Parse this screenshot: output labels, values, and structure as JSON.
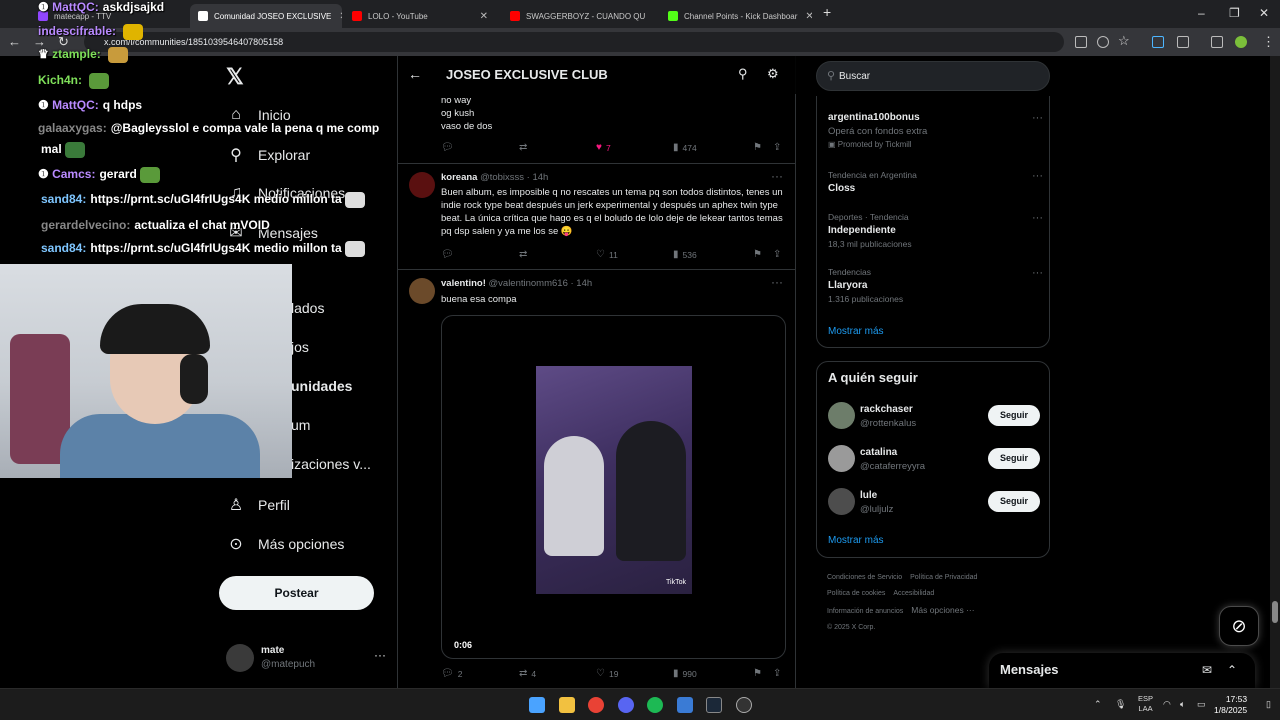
{
  "browser": {
    "tabs": [
      {
        "label": "matecapp - TTV",
        "color": "#9146ff"
      },
      {
        "label": "Comunidad JOSEO EXCLUSIVE",
        "color": "#ffffff"
      },
      {
        "label": "LOLO - YouTube",
        "color": "#ff0000"
      },
      {
        "label": "SWAGGERBOYZ - CUANDO QU",
        "color": "#ff0000"
      },
      {
        "label": "Channel Points - Kick Dashboar",
        "color": "#53fc18"
      }
    ],
    "url": "x.com/i/communities/1851039546407805158"
  },
  "nav": {
    "items": [
      {
        "label": "Inicio",
        "icon": "home-icon"
      },
      {
        "label": "Explorar",
        "icon": "search-icon"
      },
      {
        "label": "Notificaciones",
        "icon": "bell-icon"
      },
      {
        "label": "Mensajes",
        "icon": "mail-icon"
      },
      {
        "label": "lados",
        "icon": "bookmark-icon"
      },
      {
        "label": "jos",
        "icon": "briefcase-icon"
      },
      {
        "label": "unidades",
        "icon": "people-icon"
      },
      {
        "label": "um",
        "icon": "star-icon"
      },
      {
        "label": "izaciones v...",
        "icon": "bolt-icon"
      },
      {
        "label": "Perfil",
        "icon": "person-icon"
      },
      {
        "label": "Más opciones",
        "icon": "more-circle-icon"
      }
    ],
    "post_label": "Postear",
    "account": {
      "name": "mate",
      "handle": "@matepuch"
    }
  },
  "feed": {
    "title": "JOSEO EXCLUSIVE CLUB",
    "tweet0": {
      "lines": [
        "no way",
        "og kush",
        "vaso de dos"
      ],
      "likes": "7",
      "views": "474"
    },
    "tweet1": {
      "name": "koreana",
      "handle": "@tobixsss · 14h",
      "text": "Buen album, es imposible q no rescates un tema pq son todos distintos, tenes un indie rock type beat después un jerk experimental y después un aphex twin type beat. La única crítica que hago es q el boludo de lolo deje de lekear tantos temas pq dsp salen y ya me los se 😛",
      "likes": "11",
      "views": "536"
    },
    "tweet2": {
      "name": "valentino!",
      "handle": "@valentinomm616 · 14h",
      "text": "buena esa compa",
      "video_time": "0:06",
      "tiktok": "TikTok",
      "replies": "2",
      "reposts": "4",
      "likes": "19",
      "views": "990"
    }
  },
  "sidebar": {
    "search_placeholder": "Buscar",
    "trends": [
      {
        "top": "",
        "name": "argentina100bonus",
        "bottom": "Operá con fondos extra",
        "extra": "Promoted by Tickmill"
      },
      {
        "top": "Tendencia en Argentina",
        "name": "Closs",
        "bottom": ""
      },
      {
        "top": "Deportes · Tendencia",
        "name": "Independiente",
        "bottom": "18,3 mil publicaciones"
      },
      {
        "top": "Tendencias",
        "name": "Llaryora",
        "bottom": "1.316 publicaciones"
      }
    ],
    "show_more": "Mostrar más",
    "who_to_follow": "A quién seguir",
    "follow": [
      {
        "name": "rackchaser",
        "handle": "@rottenkalus",
        "button": "Seguir"
      },
      {
        "name": "catalina",
        "handle": "@cataferreyyra",
        "button": "Seguir"
      },
      {
        "name": "lule",
        "handle": "@luljulz",
        "button": "Seguir"
      }
    ],
    "footer": [
      "Condiciones de Servicio",
      "Política de Privacidad",
      "Política de cookies",
      "Accesibilidad",
      "Información de anuncios",
      "Más opciones ···",
      "© 2025 X Corp."
    ]
  },
  "messages_drawer": "Mensajes",
  "chat": [
    {
      "user": "MattQC:",
      "msg": "askdjsajkd",
      "color": "#b98aff"
    },
    {
      "user": "indescifrable:",
      "msg": "",
      "color": "#b98aff"
    },
    {
      "user": "ztample:",
      "msg": "",
      "color": "#7fe05a"
    },
    {
      "user": "Kich4n:",
      "msg": "",
      "color": "#7fe05a"
    },
    {
      "user": "MattQC:",
      "msg": "q hdps",
      "color": "#b98aff"
    },
    {
      "user": "galaaxygas:",
      "msg": "@Bagleysslol e compa vale la pena q me comp",
      "color": "#888888"
    },
    {
      "user": "",
      "msg": "mal",
      "color": "#ffffff"
    },
    {
      "user": "Camcs:",
      "msg": "gerard",
      "color": "#b98aff"
    },
    {
      "user": "sand84:",
      "msg": "https://prnt.sc/uGl4frIUgs4K medio millon ta",
      "color": "#7fc6ff"
    },
    {
      "user": "gerardelvecino:",
      "msg": "actualiza el chat mVOID",
      "color": "#888888"
    },
    {
      "user": "sand84:",
      "msg": "https://prnt.sc/uGl4frIUgs4K medio millon ta",
      "color": "#7fc6ff"
    }
  ],
  "taskbar": {
    "lang1": "ESP",
    "lang2": "LAA",
    "time": "17:53",
    "date": "1/8/2025"
  }
}
